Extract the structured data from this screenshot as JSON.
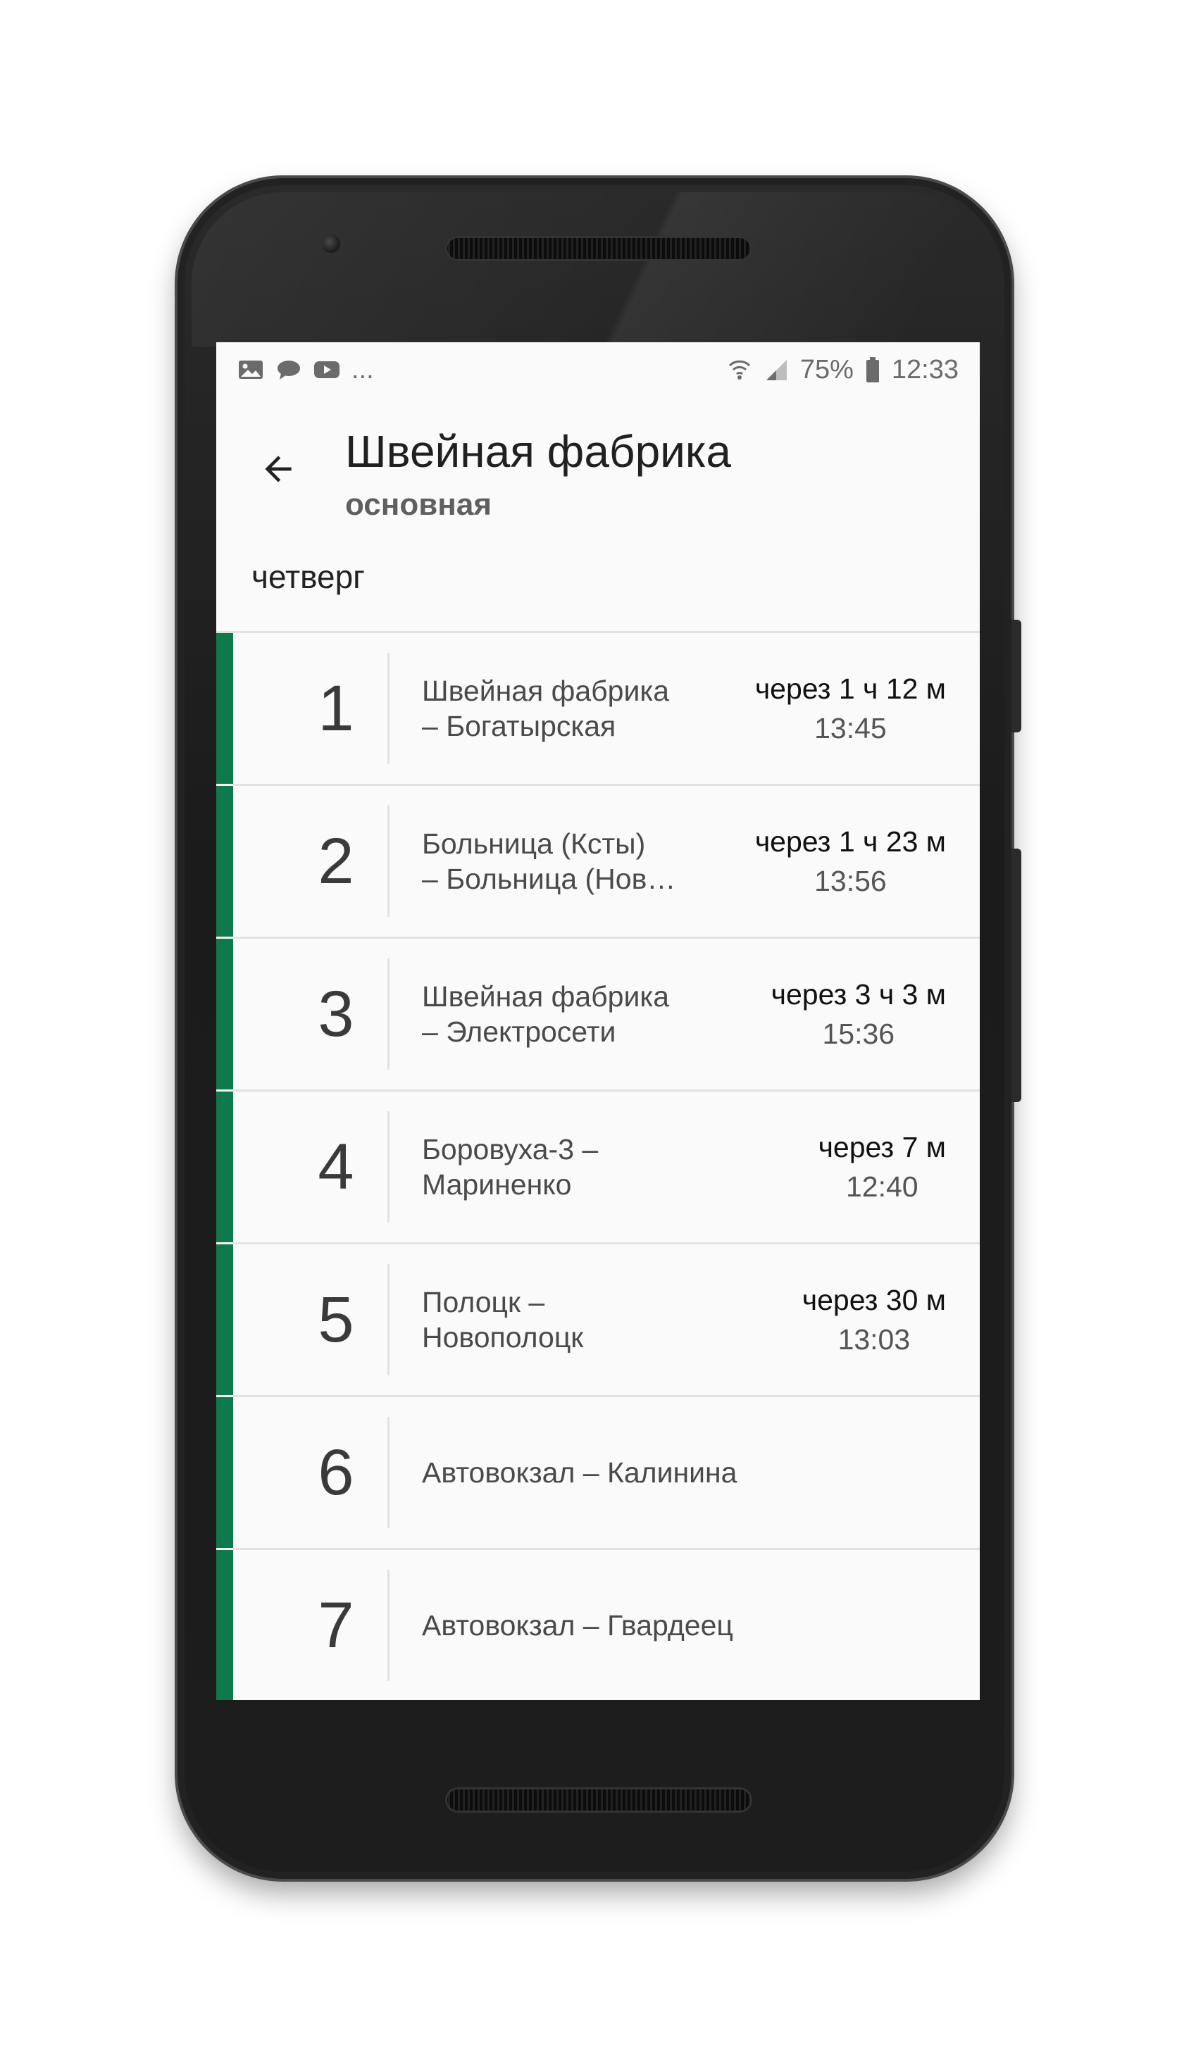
{
  "statusbar": {
    "left_icons": [
      "image-icon",
      "chat-icon",
      "youtube-icon"
    ],
    "more": "...",
    "battery": "75%",
    "time": "12:33"
  },
  "header": {
    "title": "Швейная фабрика",
    "subtitle": "основная"
  },
  "day": "четверг",
  "accent_color": "#0e7a4b",
  "routes": [
    {
      "number": "1",
      "name_line1": "Швейная фабрика",
      "name_line2": "– Богатырская",
      "relative": "через 1 ч 12 м",
      "time": "13:45"
    },
    {
      "number": "2",
      "name_line1": "Больница (Ксты)",
      "name_line2": "– Больница (Нов…",
      "relative": "через 1 ч 23 м",
      "time": "13:56"
    },
    {
      "number": "3",
      "name_line1": "Швейная фабрика",
      "name_line2": "– Электросети",
      "relative": "через 3 ч 3 м",
      "time": "15:36"
    },
    {
      "number": "4",
      "name_line1": "Боровуха-3 –",
      "name_line2": "Мариненко",
      "relative": "через 7 м",
      "time": "12:40"
    },
    {
      "number": "5",
      "name_line1": "Полоцк –",
      "name_line2": "Новополоцк",
      "relative": "через 30 м",
      "time": "13:03"
    },
    {
      "number": "6",
      "name_line1": "Автовокзал – Калинина",
      "name_line2": "",
      "relative": "",
      "time": ""
    },
    {
      "number": "7",
      "name_line1": "Автовокзал – Гвардеец",
      "name_line2": "",
      "relative": "",
      "time": ""
    }
  ]
}
